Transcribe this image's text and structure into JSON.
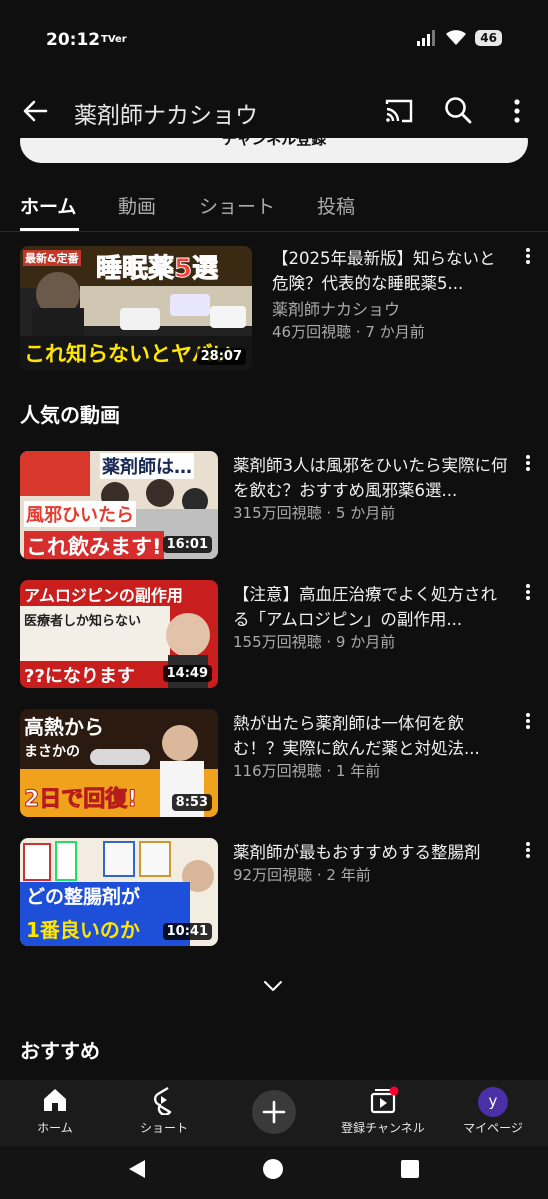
{
  "status_bar": {
    "time": "20:12",
    "tv_badge": "TVer",
    "battery": "46"
  },
  "app_bar": {
    "title": "薬剤師ナカショウ",
    "icons": [
      "back-arrow-icon",
      "cast-icon",
      "search-icon",
      "more-vert-icon"
    ]
  },
  "subscribe_label": "チャンネル登録",
  "tabs": [
    {
      "label": "ホーム",
      "active": true
    },
    {
      "label": "動画"
    },
    {
      "label": "ショート"
    },
    {
      "label": "投稿"
    }
  ],
  "featured": {
    "title": "【2025年最新版】知らないと危険？代表的な睡眠薬5...",
    "channel": "薬剤師ナカショウ",
    "meta": "46万回視聴 · 7 か月前",
    "duration": "28:07",
    "thumb_text": {
      "badge": "最新&定番",
      "main": "睡眠薬5選",
      "bottom": "これ知らないとヤバい"
    }
  },
  "popular": {
    "heading": "人気の動画",
    "videos": [
      {
        "title": "薬剤師3人は風邪をひいたら実際に何を飲む？おすすめ風邪薬6選...",
        "meta": "315万回視聴 · 5 か月前",
        "duration": "16:01",
        "thumb_text": {
          "top": "薬剤師は…",
          "mid": "風邪ひいたら",
          "bottom": "これ飲みます!"
        }
      },
      {
        "title": "【注意】高血圧治療でよく処方される「アムロジピン」の副作用...",
        "meta": "155万回視聴 · 9 か月前",
        "duration": "14:49",
        "thumb_text": {
          "top": "アムロジピンの副作用",
          "mid": "医療者しか知らない",
          "bottom": "??になります"
        }
      },
      {
        "title": "熱が出たら薬剤師は一体何を飲む！？実際に飲んだ薬と対処法...",
        "meta": "116万回視聴 · 1 年前",
        "duration": "8:53",
        "thumb_text": {
          "top": "高熱から",
          "mid": "まさかの",
          "bottom": "2日で回復!"
        }
      },
      {
        "title": "薬剤師が最もおすすめする整腸剤",
        "meta": "92万回視聴 · 2 年前",
        "duration": "10:41",
        "thumb_text": {
          "top": "",
          "mid": "どの整腸剤が",
          "bottom": "1番良いのか"
        }
      }
    ]
  },
  "recommended_heading": "おすすめ",
  "bottom_nav": [
    {
      "label": "ホーム",
      "icon": "home-icon"
    },
    {
      "label": "ショート",
      "icon": "shorts-icon"
    },
    {
      "label": "",
      "icon": "create-plus-icon"
    },
    {
      "label": "登録チャンネル",
      "icon": "subscriptions-icon"
    },
    {
      "label": "マイページ",
      "icon": "avatar-icon",
      "avatar_letter": "y"
    }
  ],
  "system_nav": [
    "back-triangle-icon",
    "home-circle-icon",
    "recents-square-icon"
  ],
  "colors": {
    "background": "#0f0f0f",
    "text": "#f1f1f1",
    "meta": "#aaaaaa",
    "notification_dot": "#ff0033",
    "avatar": "#4b2fa6"
  }
}
